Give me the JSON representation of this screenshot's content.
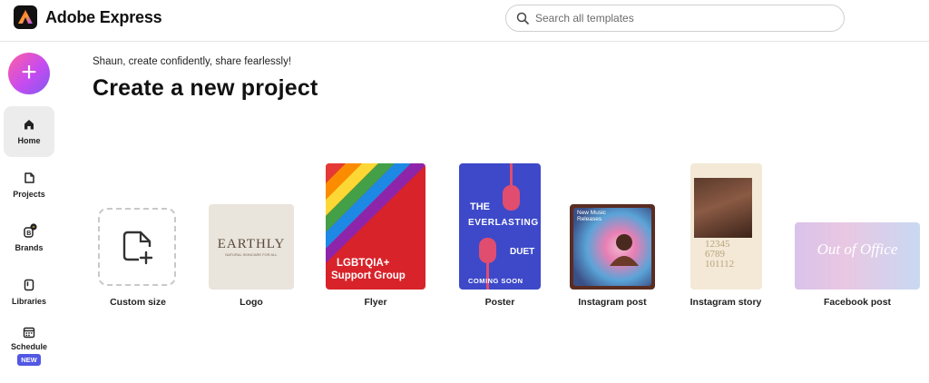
{
  "app": {
    "title": "Adobe Express"
  },
  "search": {
    "placeholder": "Search all templates"
  },
  "sidebar": {
    "create_label": "+",
    "items": [
      {
        "label": "Home",
        "icon": "home-icon",
        "active": true
      },
      {
        "label": "Projects",
        "icon": "projects-icon"
      },
      {
        "label": "Brands",
        "icon": "brands-icon"
      },
      {
        "label": "Libraries",
        "icon": "libraries-icon"
      },
      {
        "label": "Schedule",
        "icon": "calendar-icon",
        "badge": "NEW"
      }
    ]
  },
  "main": {
    "tagline": "Shaun, create confidently, share fearlessly!",
    "title": "Create a new project"
  },
  "projects": [
    {
      "label": "Custom size"
    },
    {
      "label": "Logo",
      "thumb_text": "EARTHLY",
      "thumb_subtext": "NATURAL SKINCARE FOR ALL"
    },
    {
      "label": "Flyer",
      "thumb_text_1": "LGBTQIA+",
      "thumb_text_2": "Support Group"
    },
    {
      "label": "Poster",
      "thumb_text_1": "THE",
      "thumb_text_2": "EVERLASTING",
      "thumb_text_3": "DUET",
      "thumb_text_4": "COMING SOON"
    },
    {
      "label": "Instagram post",
      "thumb_text": "New Music Releases"
    },
    {
      "label": "Instagram story",
      "thumb_text": "12345 6789 101112"
    },
    {
      "label": "Facebook post",
      "thumb_text": "Out of Office"
    }
  ],
  "colors": {
    "accent_gradient_start": "#ff5fa2",
    "accent_gradient_end": "#7f5af0",
    "badge": "#5258e4"
  }
}
